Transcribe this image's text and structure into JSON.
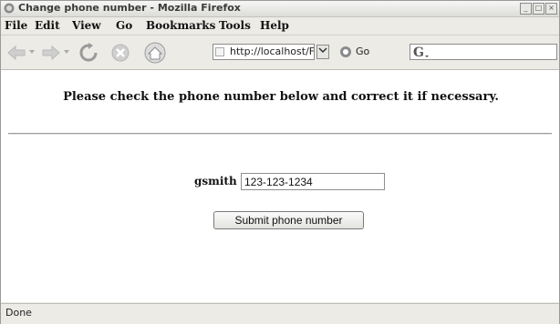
{
  "window": {
    "title": "Change phone number - Mozilla Firefox"
  },
  "menubar": {
    "items": [
      {
        "label": "File",
        "mnemonic": "F"
      },
      {
        "label": "Edit",
        "mnemonic": "E"
      },
      {
        "label": "View",
        "mnemonic": "V"
      },
      {
        "label": "Go",
        "mnemonic": "G"
      },
      {
        "label": "Bookmarks",
        "mnemonic": "B"
      },
      {
        "label": "Tools",
        "mnemonic": "T"
      },
      {
        "label": "Help",
        "mnemonic": "H"
      }
    ]
  },
  "toolbar": {
    "url": "http://localhost/F",
    "go_label": "Go",
    "icons": [
      "back-icon",
      "forward-icon",
      "reload-icon",
      "stop-icon",
      "home-icon",
      "go-icon",
      "search-engine-icon"
    ]
  },
  "page": {
    "message": "Please check the phone number below and correct it if necessary.",
    "username": "gsmith",
    "phone_value": "123-123-1234",
    "submit_label": "Submit phone number"
  },
  "status": {
    "text": "Done"
  }
}
